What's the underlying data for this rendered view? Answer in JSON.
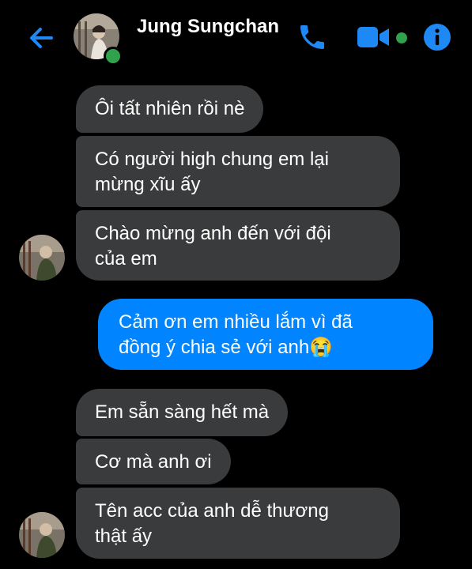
{
  "header": {
    "contact_name": "Jung Sungchan",
    "back_icon": "back-arrow-icon",
    "call_icon": "phone-icon",
    "video_icon": "video-camera-icon",
    "info_icon": "info-icon",
    "accent_color": "#0084ff",
    "online_color": "#31a24c"
  },
  "messages": [
    {
      "from": "contact",
      "lines": [
        "Ôi tất nhiên rồi nè"
      ]
    },
    {
      "from": "contact",
      "lines": [
        "Có người high chung em lại",
        "mừng xĩu ấy"
      ]
    },
    {
      "from": "contact",
      "lines": [
        "Chào mừng anh đến với đội",
        "của em"
      ]
    },
    {
      "from": "me",
      "lines": [
        "Cảm ơn em nhiều lắm vì đã",
        "đồng ý chia sẻ với anh"
      ],
      "emoji": "😭"
    },
    {
      "from": "contact",
      "lines": [
        "Em sẵn sàng hết mà"
      ]
    },
    {
      "from": "contact",
      "lines": [
        "Cơ mà anh ơi"
      ]
    },
    {
      "from": "contact",
      "lines": [
        "Tên acc của anh dễ thương",
        "thật ấy"
      ]
    }
  ],
  "colors": {
    "incoming_bubble": "#3a3b3c",
    "outgoing_bubble": "#0084ff",
    "background": "#000000"
  }
}
